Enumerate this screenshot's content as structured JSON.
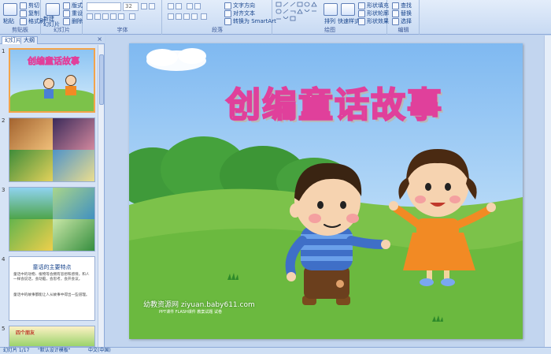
{
  "ribbon": {
    "clipboard": {
      "label": "剪贴板",
      "paste": "粘贴",
      "cut": "剪切",
      "copy": "复制",
      "format_painter": "格式刷"
    },
    "slides": {
      "label": "幻灯片",
      "new_slide": "新建\n幻灯片",
      "layout": "版式",
      "reset": "重设",
      "delete": "删除"
    },
    "font": {
      "label": "字体",
      "font_name": "",
      "font_size": "32"
    },
    "paragraph": {
      "label": "段落",
      "text_direction": "文字方向",
      "align_text": "对齐文本",
      "smartart": "转换为 SmartArt"
    },
    "drawing": {
      "label": "绘图",
      "arrange": "排列",
      "quick_styles": "快速样式",
      "shape_fill": "形状填充",
      "shape_outline": "形状轮廓",
      "shape_effects": "形状效果"
    },
    "editing": {
      "label": "编辑",
      "find": "查找",
      "replace": "替换",
      "select": "选择"
    }
  },
  "left_pane": {
    "tabs": {
      "slides": "幻灯片",
      "outline": "大纲"
    },
    "close": "×",
    "thumbnails": [
      {
        "number": "1",
        "title": "创编童话故事"
      },
      {
        "number": "2",
        "title": ""
      },
      {
        "number": "3",
        "title": ""
      },
      {
        "number": "4",
        "title": "童话的主要特点",
        "bullet1": "童话中的动物、植物等会拥有思想和感情，和人一样会说话，会动脑，会思考，会开会议。",
        "bullet2": "童话中的故事都能让人从故事中得出一些道理。"
      },
      {
        "number": "5",
        "title": "四个朋友"
      }
    ]
  },
  "slide": {
    "title": "创编童话故事",
    "caption": "幼教资源网 ziyuan.baby611.com",
    "caption_sub": "PPT课件 FLASH课件 教案试题 试卷"
  },
  "status_bar": {
    "slide_counter": "幻灯片 1/17",
    "theme": "\"默认设计模板\"",
    "language": "中文(中国)"
  },
  "colors": {
    "ribbon_bg": "#dbe7f7",
    "sky": "#7fb9f1",
    "grass": "#7cc24a",
    "title_stroke": "#e0409b"
  }
}
